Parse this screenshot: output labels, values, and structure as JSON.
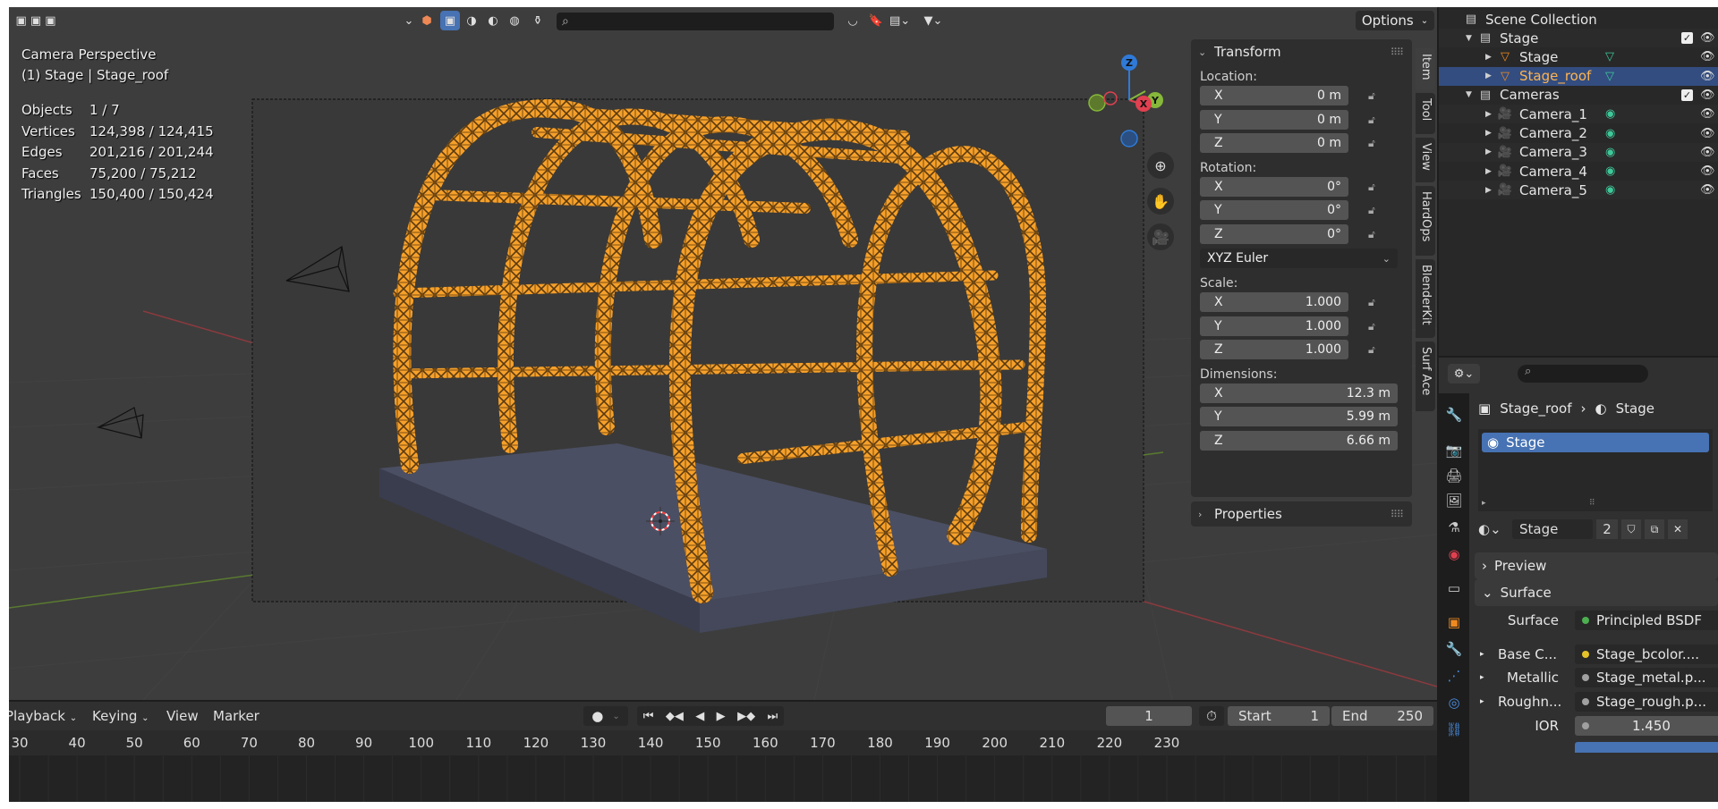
{
  "viewport": {
    "header": {
      "options_label": "Options"
    },
    "overlay": {
      "view_name": "Camera Perspective",
      "object_info": "(1) Stage | Stage_roof"
    },
    "stats": [
      {
        "label": "Objects",
        "value": "1 / 7"
      },
      {
        "label": "Vertices",
        "value": "124,398 / 124,415"
      },
      {
        "label": "Edges",
        "value": "201,216 / 201,244"
      },
      {
        "label": "Faces",
        "value": "75,200 / 75,212"
      },
      {
        "label": "Triangles",
        "value": "150,400 / 150,424"
      }
    ],
    "gizmo_axes": {
      "z": "Z",
      "y": "Y",
      "x": "X"
    },
    "colors": {
      "selection": "#f5a02a",
      "x_axis": "#e04050",
      "y_axis": "#86b83a",
      "z_axis": "#2f7ad8"
    }
  },
  "npanel": {
    "transform_title": "Transform",
    "location_label": "Location:",
    "location": [
      {
        "axis": "X",
        "value": "0 m"
      },
      {
        "axis": "Y",
        "value": "0 m"
      },
      {
        "axis": "Z",
        "value": "0 m"
      }
    ],
    "rotation_label": "Rotation:",
    "rotation": [
      {
        "axis": "X",
        "value": "0°"
      },
      {
        "axis": "Y",
        "value": "0°"
      },
      {
        "axis": "Z",
        "value": "0°"
      }
    ],
    "rotation_mode": "XYZ Euler",
    "scale_label": "Scale:",
    "scale": [
      {
        "axis": "X",
        "value": "1.000"
      },
      {
        "axis": "Y",
        "value": "1.000"
      },
      {
        "axis": "Z",
        "value": "1.000"
      }
    ],
    "dimensions_label": "Dimensions:",
    "dimensions": [
      {
        "axis": "X",
        "value": "12.3 m"
      },
      {
        "axis": "Y",
        "value": "5.99 m"
      },
      {
        "axis": "Z",
        "value": "6.66 m"
      }
    ],
    "properties_title": "Properties",
    "tabs": [
      "Item",
      "Tool",
      "View",
      "HardOps",
      "BlenderKit",
      "Surf Ace"
    ]
  },
  "timeline": {
    "menus": [
      "Playback",
      "Keying",
      "View",
      "Marker"
    ],
    "current_frame": "1",
    "start_label": "Start",
    "start_value": "1",
    "end_label": "End",
    "end_value": "250",
    "ticks": [
      "30",
      "40",
      "50",
      "60",
      "70",
      "80",
      "90",
      "100",
      "110",
      "120",
      "130",
      "140",
      "150",
      "160",
      "170",
      "180",
      "190",
      "200",
      "210",
      "220",
      "230"
    ]
  },
  "outliner": {
    "root": "Scene Collection",
    "items": [
      {
        "name": "Stage",
        "kind": "collection",
        "depth": 1
      },
      {
        "name": "Stage",
        "kind": "mesh",
        "depth": 2
      },
      {
        "name": "Stage_roof",
        "kind": "mesh",
        "depth": 2,
        "selected": true
      },
      {
        "name": "Cameras",
        "kind": "collection",
        "depth": 1
      },
      {
        "name": "Camera_1",
        "kind": "camera",
        "depth": 2
      },
      {
        "name": "Camera_2",
        "kind": "camera",
        "depth": 2
      },
      {
        "name": "Camera_3",
        "kind": "camera",
        "depth": 2
      },
      {
        "name": "Camera_4",
        "kind": "camera",
        "depth": 2
      },
      {
        "name": "Camera_5",
        "kind": "camera",
        "depth": 2
      }
    ]
  },
  "properties": {
    "breadcrumb_object": "Stage_roof",
    "breadcrumb_material": "Stage",
    "slot_name": "Stage",
    "material_name": "Stage",
    "user_count": "2",
    "preview_label": "Preview",
    "surface_label": "Surface",
    "fields": [
      {
        "label": "Surface",
        "value": "Principled BSDF",
        "dot": "#4caf50"
      },
      {
        "label": "Base C...",
        "value": "Stage_bcolor....",
        "dot": "#e6c229"
      },
      {
        "label": "Metallic",
        "value": "Stage_metal.p...",
        "dot": "#a0a0a0"
      },
      {
        "label": "Roughn...",
        "value": "Stage_rough.p...",
        "dot": "#a0a0a0"
      },
      {
        "label": "IOR",
        "value": "1.450",
        "dot": "#a0a0a0"
      }
    ]
  }
}
